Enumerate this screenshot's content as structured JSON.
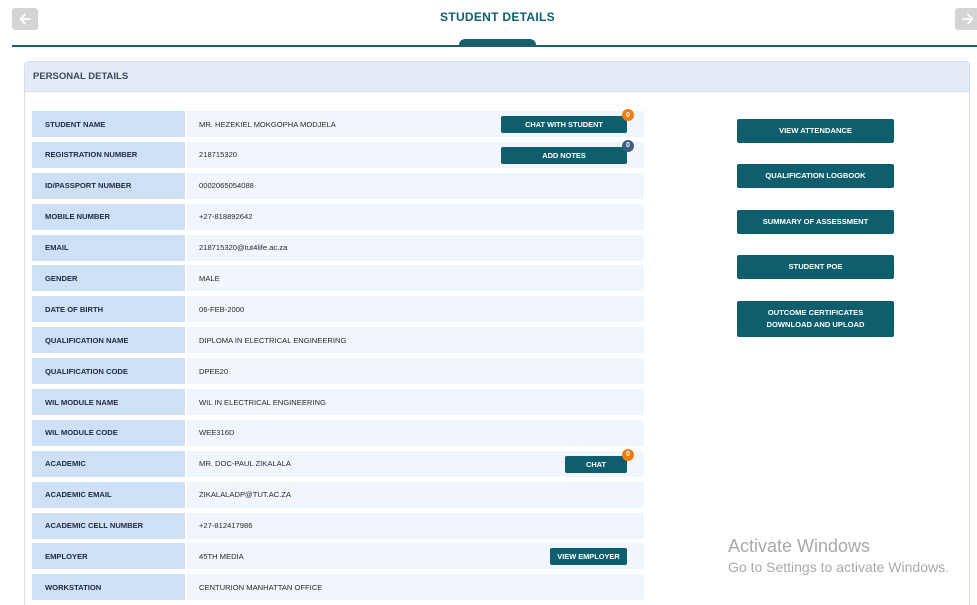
{
  "header": {
    "title": "STUDENT DETAILS"
  },
  "panel": {
    "title": "PERSONAL DETAILS"
  },
  "rows": [
    {
      "label": "STUDENT NAME",
      "value": "MR. HEZEKIEL MOKGOPHA MODJELA",
      "button": "CHAT WITH STUDENT",
      "badge": "0"
    },
    {
      "label": "REGISTRATION NUMBER",
      "value": "218715320",
      "button": "ADD NOTES",
      "badge": "0"
    },
    {
      "label": "ID/PASSPORT NUMBER",
      "value": "0002065054088"
    },
    {
      "label": "MOBILE NUMBER",
      "value": "+27-818892642"
    },
    {
      "label": "EMAIL",
      "value": "218715320@tut4life.ac.za"
    },
    {
      "label": "GENDER",
      "value": "MALE"
    },
    {
      "label": "DATE OF BIRTH",
      "value": "06-FEB-2000"
    },
    {
      "label": "QUALIFICATION NAME",
      "value": "DIPLOMA IN ELECTRICAL ENGINEERING"
    },
    {
      "label": "QUALIFICATION CODE",
      "value": "DPEE20"
    },
    {
      "label": "WIL MODULE NAME",
      "value": "WIL IN ELECTRICAL ENGINEERING"
    },
    {
      "label": "WIL MODULE CODE",
      "value": "WEE316D"
    },
    {
      "label": "ACADEMIC",
      "value": "MR. DOC-PAUL ZIKALALA",
      "button": "CHAT",
      "badge": "0"
    },
    {
      "label": "ACADEMIC EMAIL",
      "value": "ZIKALALADP@TUT.AC.ZA"
    },
    {
      "label": "ACADEMIC CELL NUMBER",
      "value": "+27-812417986"
    },
    {
      "label": "EMPLOYER",
      "value": "45TH MEDIA",
      "button": "VIEW EMPLOYER"
    },
    {
      "label": "WORKSTATION",
      "value": "CENTURION MANHATTAN OFFICE"
    }
  ],
  "actions": {
    "view_attendance": "VIEW ATTENDANCE",
    "qualification_logbook": "QUALIFICATION LOGBOOK",
    "summary_of_assessment": "SUMMARY OF ASSESSMENT",
    "student_poe": "STUDENT POE",
    "outcome_certificates_line1": "OUTCOME CERTIFICATES",
    "outcome_certificates_line2": "DOWNLOAD AND UPLOAD"
  },
  "watermark": {
    "line1": "Activate Windows",
    "line2": "Go to Settings to activate Windows."
  },
  "icons": {
    "back": "arrow-left-icon",
    "forward": "arrow-right-icon"
  },
  "colors": {
    "accent": "#0f5e6d",
    "label_bg": "#cde0f5",
    "value_bg": "#f1f6fc",
    "badge_orange": "#ef7d10",
    "badge_blue": "#3e5f84"
  }
}
